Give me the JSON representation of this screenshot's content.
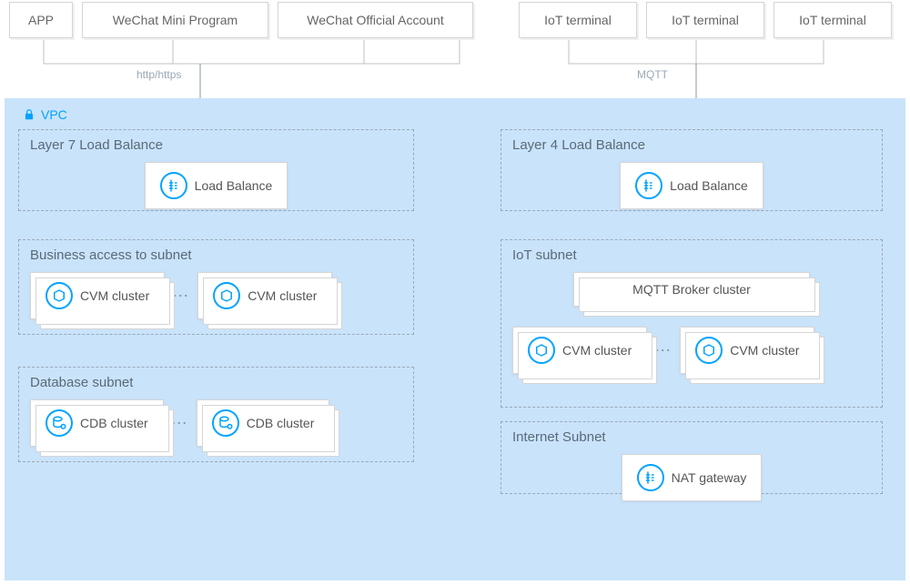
{
  "top_clients": {
    "app": "APP",
    "wechat_mini": "WeChat Mini Program",
    "wechat_official": "WeChat Official Account",
    "iot1": "IoT terminal",
    "iot2": "IoT terminal",
    "iot3": "IoT terminal"
  },
  "protocols": {
    "http": "http/https",
    "mqtt": "MQTT"
  },
  "vpc_label": "VPC",
  "left": {
    "l7_title": "Layer 7 Load Balance",
    "l7_node": "Load Balance",
    "biz_title": "Business access to subnet",
    "biz_node": "CVM cluster",
    "db_title": "Database subnet",
    "db_node": "CDB cluster"
  },
  "right": {
    "l4_title": "Layer 4 Load Balance",
    "l4_node": "Load Balance",
    "iot_title": "IoT subnet",
    "mqtt_node": "MQTT Broker cluster",
    "cvm_node": "CVM cluster",
    "internet_title": "Internet  Subnet",
    "nat_node": "NAT gateway"
  },
  "ellipsis": "⋯"
}
